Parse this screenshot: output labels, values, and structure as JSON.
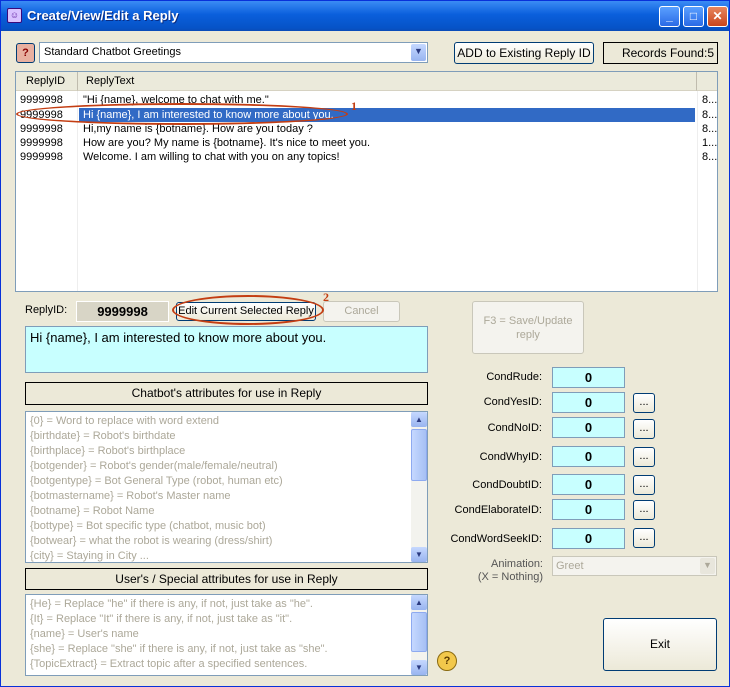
{
  "window": {
    "title": "Create/View/Edit a Reply",
    "minimize": "_",
    "maximize": "□",
    "close": "✕"
  },
  "toolbar": {
    "help_icon": "?",
    "category_value": "Standard Chatbot Greetings",
    "add_button": "ADD to Existing Reply ID",
    "records_found": "Records Found:5"
  },
  "grid": {
    "columns": [
      "ReplyID",
      "ReplyText"
    ],
    "rows": [
      {
        "id": "9999998",
        "text": "\"Hi {name}, welcome to chat with me.\"",
        "extra": "8..."
      },
      {
        "id": "9999998",
        "text": "Hi {name}, I am interested to know more about you.",
        "extra": "8..."
      },
      {
        "id": "9999998",
        "text": "Hi,my name is {botname}. How are you today ?",
        "extra": "8..."
      },
      {
        "id": "9999998",
        "text": "How are you? My name is {botname}. It's nice to meet you.",
        "extra": "1..."
      },
      {
        "id": "9999998",
        "text": "Welcome. I am willing to chat with you on any topics!",
        "extra": "8..."
      }
    ],
    "selected_index": 1
  },
  "annotations": {
    "one": "1",
    "two": "2"
  },
  "edit": {
    "reply_id_label": "ReplyID:",
    "reply_id_value": "9999998",
    "edit_button": "Edit Current Selected Reply",
    "cancel_button": "Cancel",
    "save_button": "F3 = Save/Update reply",
    "reply_text": "Hi {name}, I am interested to know more about you."
  },
  "chatbot_attributes": {
    "title": "Chatbot's attributes for use in Reply",
    "items": [
      "{0} = Word to replace with word extend",
      "{birthdate} = Robot's birthdate",
      "{birthplace} = Robot's birthplace",
      "{botgender} = Robot's gender(male/female/neutral)",
      "{botgentype} = Bot General Type (robot, human etc)",
      "{botmastername} = Robot's Master name",
      "{botname} = Robot Name",
      "{bottype} = Bot specific type (chatbot, music bot)",
      "{botwear} = what the robot is wearing (dress/shirt)",
      "{city} = Staying in City ..."
    ]
  },
  "user_attributes": {
    "title": "User's / Special attributes for use in Reply",
    "items": [
      "{He} = Replace \"he\" if there is any, if not, just take as \"he\".",
      "{It} = Replace \"It\" if there is any, if not, just take as \"it\".",
      "{name} = User's name",
      "{she} = Replace \"she\" if there is any, if not, just take as \"she\".",
      "{TopicExtract} = Extract topic after a specified sentences."
    ]
  },
  "conditions": [
    {
      "label": "CondRude:",
      "value": "0"
    },
    {
      "label": "CondYesID:",
      "value": "0"
    },
    {
      "label": "CondNoID:",
      "value": "0"
    },
    {
      "label": "CondWhyID:",
      "value": "0"
    },
    {
      "label": "CondDoubtID:",
      "value": "0"
    },
    {
      "label": "CondElaborateID:",
      "value": "0"
    },
    {
      "label": "CondWordSeekID:",
      "value": "0"
    }
  ],
  "ellipsis": "...",
  "animation": {
    "label_line1": "Animation:",
    "label_line2": "(X = Nothing)",
    "value": "Greet"
  },
  "exit_button": "Exit",
  "colors": {
    "selection": "#316ac5",
    "cyan_field": "#c8ffff",
    "annotation": "#c33d12",
    "titlebar": "#0a5fdc"
  }
}
